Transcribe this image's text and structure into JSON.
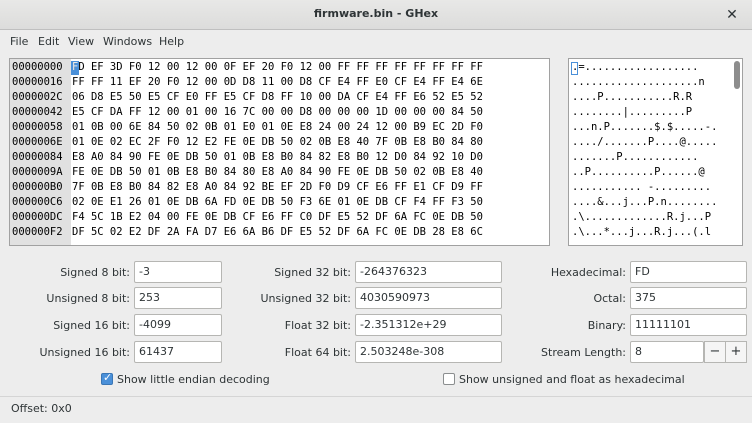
{
  "window": {
    "title": "firmware.bin - GHex",
    "close_glyph": "✕"
  },
  "menu": [
    "File",
    "Edit",
    "View",
    "Windows",
    "Help"
  ],
  "hex_view": {
    "cursor_char": "F",
    "offsets": [
      "00000000",
      "00000016",
      "0000002C",
      "00000042",
      "00000058",
      "0000006E",
      "00000084",
      "0000009A",
      "000000B0",
      "000000C6",
      "000000DC",
      "000000F2"
    ],
    "hex_rows": [
      "FD EF 3D F0 12 00 12 00 0F EF 20 F0 12 00 FF FF FF FF FF FF FF FF",
      "FF FF 11 EF 20 F0 12 00 0D D8 11 00 D8 CF E4 FF E0 CF E4 FF E4 6E",
      "06 D8 E5 50 E5 CF E0 FF E5 CF D8 FF 10 00 DA CF E4 FF E6 52 E5 52",
      "E5 CF DA FF 12 00 01 00 16 7C 00 00 D8 00 00 00 1D 00 00 00 84 50",
      "01 0B 00 6E 84 50 02 0B 01 E0 01 0E E8 24 00 24 12 00 B9 EC 2D F0",
      "01 0E 02 EC 2F F0 12 E2 FE 0E DB 50 02 0B E8 40 7F 0B E8 B0 84 80",
      "E8 A0 84 90 FE 0E DB 50 01 0B E8 B0 84 82 E8 B0 12 D0 84 92 10 D0",
      "FE 0E DB 50 01 0B E8 B0 84 80 E8 A0 84 90 FE 0E DB 50 02 0B E8 40",
      "7F 0B E8 B0 84 82 E8 A0 84 92 BE EF 2D F0 D9 CF E6 FF E1 CF D9 FF",
      "02 0E E1 26 01 0E DB 6A FD 0E DB 50 F3 6E 01 0E DB CF F4 FF F3 50",
      "F4 5C 1B E2 04 00 FE 0E DB CF E6 FF C0 DF E5 52 DF 6A FC 0E DB 50",
      "DF 5C 02 E2 DF 2A FA D7 E6 6A B6 DF E5 52 DF 6A FC 0E DB 28 E8 6C"
    ],
    "ascii_rows": [
      ".=..................",
      "....................n",
      "....P...........R.R",
      "........|.........P",
      "...n.P.......$.$.....-.",
      "..../.......P....@.....",
      ".......P............",
      "..P..........P......@",
      "........... -.........",
      "....&...j...P.n........",
      ".\\.............R.j...P",
      ".\\...*...j...R.j...(.l"
    ]
  },
  "fields": {
    "signed8_label": "Signed 8 bit:",
    "signed8": "-3",
    "unsigned8_label": "Unsigned 8 bit:",
    "unsigned8": "253",
    "signed16_label": "Signed 16 bit:",
    "signed16": "-4099",
    "unsigned16_label": "Unsigned 16 bit:",
    "unsigned16": "61437",
    "signed32_label": "Signed 32 bit:",
    "signed32": "-264376323",
    "unsigned32_label": "Unsigned 32 bit:",
    "unsigned32": "4030590973",
    "float32_label": "Float 32 bit:",
    "float32": "-2.351312e+29",
    "float64_label": "Float 64 bit:",
    "float64": "2.503248e-308",
    "hex_label": "Hexadecimal:",
    "hex": "FD",
    "octal_label": "Octal:",
    "octal": "375",
    "binary_label": "Binary:",
    "binary": "11111101",
    "stream_label": "Stream Length:",
    "stream": "8",
    "minus": "−",
    "plus": "+"
  },
  "options": {
    "little_endian_label": "Show little endian decoding",
    "little_endian_checked": true,
    "unsigned_hex_label": "Show unsigned and float as hexadecimal",
    "unsigned_hex_checked": false
  },
  "status": {
    "offset_text": "Offset: 0x0"
  },
  "colors": {
    "cursor": "#4a90d9",
    "offset_column": "#e1e1e1"
  }
}
